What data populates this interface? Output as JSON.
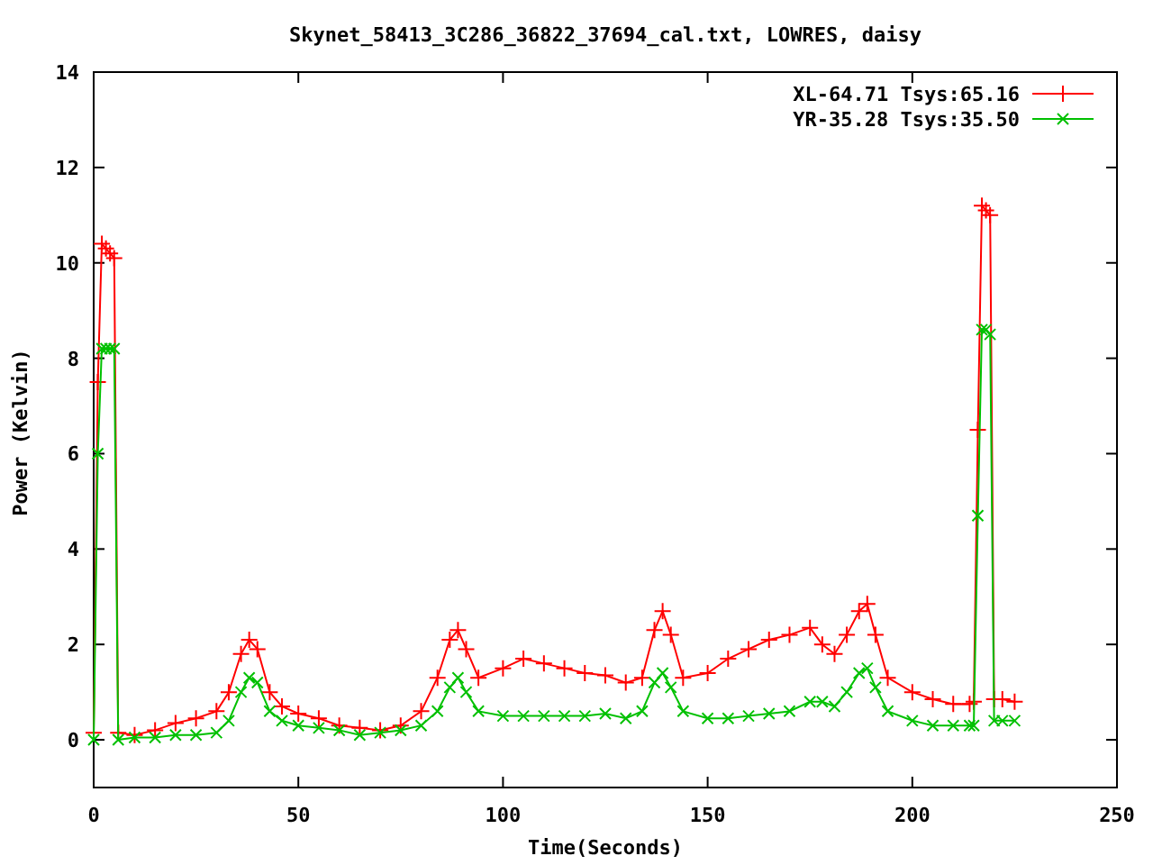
{
  "chart_data": {
    "type": "line",
    "legend": "top right",
    "title": "Skynet_58413_3C286_36822_37694_cal.txt, LOWRES, daisy",
    "xlabel": "Time(Seconds)",
    "ylabel": "Power (Kelvin)",
    "x": [
      0,
      1,
      2,
      3,
      4,
      5,
      6,
      10,
      15,
      20,
      25,
      30,
      33,
      36,
      38,
      40,
      43,
      46,
      50,
      55,
      60,
      65,
      70,
      75,
      80,
      84,
      87,
      89,
      91,
      94,
      100,
      105,
      110,
      115,
      120,
      125,
      130,
      134,
      137,
      139,
      141,
      144,
      150,
      155,
      160,
      165,
      170,
      175,
      178,
      181,
      184,
      187,
      189,
      191,
      194,
      200,
      205,
      210,
      214,
      215,
      216,
      217,
      218,
      219,
      220,
      222,
      225
    ],
    "series": [
      {
        "name": "XL-64.71 Tsys:65.16",
        "color": "#ff0000",
        "marker": "plus",
        "values": [
          0.15,
          7.5,
          10.4,
          10.3,
          10.2,
          10.1,
          0.15,
          0.1,
          0.2,
          0.35,
          0.45,
          0.6,
          1.0,
          1.8,
          2.1,
          1.9,
          1.0,
          0.7,
          0.55,
          0.45,
          0.3,
          0.25,
          0.2,
          0.3,
          0.6,
          1.3,
          2.1,
          2.3,
          1.9,
          1.3,
          1.5,
          1.7,
          1.6,
          1.5,
          1.4,
          1.35,
          1.2,
          1.3,
          2.3,
          2.7,
          2.2,
          1.3,
          1.4,
          1.7,
          1.9,
          2.1,
          2.2,
          2.35,
          2.0,
          1.8,
          2.2,
          2.7,
          2.85,
          2.2,
          1.3,
          1.0,
          0.85,
          0.75,
          0.75,
          0.8,
          6.5,
          11.2,
          11.1,
          11.0,
          0.85,
          0.85,
          0.8
        ]
      },
      {
        "name": "YR-35.28 Tsys:35.50",
        "color": "#00c000",
        "marker": "cross",
        "values": [
          0.0,
          6.0,
          8.2,
          8.2,
          8.2,
          8.2,
          0.0,
          0.05,
          0.05,
          0.1,
          0.1,
          0.15,
          0.4,
          1.0,
          1.3,
          1.2,
          0.6,
          0.4,
          0.3,
          0.25,
          0.2,
          0.1,
          0.15,
          0.2,
          0.3,
          0.6,
          1.1,
          1.3,
          1.0,
          0.6,
          0.5,
          0.5,
          0.5,
          0.5,
          0.5,
          0.55,
          0.45,
          0.6,
          1.2,
          1.4,
          1.1,
          0.6,
          0.45,
          0.45,
          0.5,
          0.55,
          0.6,
          0.8,
          0.8,
          0.7,
          1.0,
          1.4,
          1.5,
          1.1,
          0.6,
          0.4,
          0.3,
          0.3,
          0.3,
          0.3,
          4.7,
          8.6,
          8.6,
          8.5,
          0.4,
          0.4,
          0.4
        ]
      }
    ],
    "xlim": [
      0,
      250
    ],
    "ylim": [
      -1,
      14
    ],
    "xticks": [
      0,
      50,
      100,
      150,
      200,
      250
    ],
    "yticks": [
      0,
      2,
      4,
      6,
      8,
      10,
      12,
      14
    ]
  }
}
